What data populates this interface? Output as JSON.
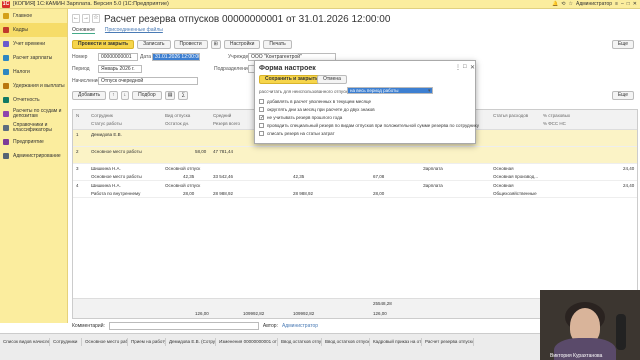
{
  "app": {
    "title": "[КОПИЯ] 1С:КАМИН Зарплата. Версия 5.0 (1С:Предприятие)",
    "user": "Администратор"
  },
  "sidebar": {
    "items": [
      {
        "label": "Главное",
        "icon": "home-icon",
        "color": "#d4a017"
      },
      {
        "label": "Кадры",
        "icon": "people-icon",
        "color": "#c0392b",
        "active": true
      },
      {
        "label": "Учет времени",
        "icon": "clock-icon",
        "color": "#6a5acd"
      },
      {
        "label": "Расчет зарплаты",
        "icon": "calculator-icon",
        "color": "#2e86c1"
      },
      {
        "label": "Налоги",
        "icon": "percent-icon",
        "color": "#2e86c1"
      },
      {
        "label": "Удержания и выплаты",
        "icon": "wallet-icon",
        "color": "#b9770e"
      },
      {
        "label": "Отчетность",
        "icon": "report-icon",
        "color": "#117a65"
      },
      {
        "label": "Расчеты по ссудам и депозитам",
        "icon": "bank-icon",
        "color": "#8e44ad"
      },
      {
        "label": "Справочники и классификаторы",
        "icon": "book-icon",
        "color": "#5d6d7e"
      },
      {
        "label": "Предприятие",
        "icon": "building-icon",
        "color": "#7d3c98"
      },
      {
        "label": "Администрирование",
        "icon": "gear-icon",
        "color": "#566573"
      }
    ]
  },
  "document": {
    "title": "Расчет резерва отпусков 00000000001 от 31.01.2026 12:00:00",
    "tabs": [
      {
        "label": "Основное"
      },
      {
        "label": "Присоединенные файлы"
      }
    ],
    "toolbar": {
      "post_close": "Провести и закрыть",
      "write": "Записать",
      "post": "Провести",
      "settings": "Настройки",
      "print": "Печать",
      "more": "Еще"
    },
    "fields": {
      "number_label": "Номер",
      "number_value": "00000000001",
      "date_label": "Дата",
      "date_value": "31.01.2026 12:00:00",
      "org_label": "Учреждение",
      "org_value": "ООО \"Контрагентрой\"",
      "period_label": "Период",
      "period_value": "Январь 2026 г.",
      "dept_label": "Подразделение",
      "accrual_label": "Начисление",
      "accrual_value": "Отпуск очередной"
    },
    "table_toolbar": {
      "add": "Добавить",
      "pick": "Подбор",
      "more": "Еще"
    },
    "columns": [
      "N",
      "Сотрудник",
      "Вид отпуска",
      "Средний",
      "",
      "",
      "Дней",
      "Подразделение",
      "Статья расходов",
      "% страховых"
    ],
    "columns2": [
      "",
      "Статус работы",
      "Остаток дн.",
      "",
      "Резерв всего",
      "",
      "",
      "Должность",
      "",
      "% ФСС НС"
    ],
    "rows": [
      {
        "n": "1",
        "employee": "Демидова Е.В.",
        "status": "",
        "type": "",
        "rest": "",
        "avg": "",
        "reserve": "",
        "days": "",
        "dept": "",
        "post": "",
        "article": "",
        "pct": ""
      },
      {
        "n": "2",
        "employee": "Основное место работы",
        "status": "",
        "type": "",
        "rest": "58,00",
        "avg": "47 781,44",
        "reserve": "",
        "days": "",
        "dept": "",
        "post": "",
        "article": "",
        "pct": ""
      },
      {
        "n": "3",
        "employee": "Шишкина Н.А.",
        "status": "Основное место работы",
        "type": "Основной отпуск",
        "rest": "42,35",
        "avg": "",
        "reserve": "33 542,46",
        "reserve2": "42,35",
        "days": "67,08",
        "dept": "Зарплата",
        "post": "Основная производ...",
        "article": "Основная",
        "pct": "24,40"
      },
      {
        "n": "4",
        "employee": "Шишкина Н.А.",
        "status": "Работа по внутреннему",
        "type": "Основной отпуск",
        "rest": "28,00",
        "avg": "",
        "reserve": "28 988,92",
        "reserve2": "28 988,92",
        "days": "28,00",
        "dept": "Зарплата",
        "post": "Общехозяйственные",
        "article": "Основная",
        "pct": "24,40"
      }
    ],
    "totals": {
      "days": "25548,28",
      "a": "126,00",
      "b": "109992,82",
      "c": "109992,82",
      "d": "126,00"
    },
    "bottom": {
      "comment_label": "Комментарий:",
      "author_label": "Автор:",
      "author_value": "Администратор"
    }
  },
  "dialog": {
    "title": "Форма настроек",
    "ok": "Сохранить и закрыть",
    "cancel": "Отмена",
    "calc_label": "рассчитать для неиспользованного отпуска",
    "calc_value": "на весь период работы",
    "options": [
      {
        "label": "добавлять в расчет уволенных в текущем месяце",
        "checked": false
      },
      {
        "label": "округлять дни за месяц при расчете до двух знаков",
        "checked": false
      },
      {
        "label": "не учитывать резерв прошлого года",
        "checked": true
      },
      {
        "label": "проводить специальный резерв по видам отпусков при положительной сумме резерва по сотруднику",
        "checked": false
      },
      {
        "label": "списать резерв на статьи затрат",
        "checked": false
      }
    ]
  },
  "taskbar": {
    "tabs": [
      "Список видов начислений",
      "Сотрудники",
      "Основное место работы",
      "Прием на работу",
      "Демидова Е.В. (Сотрудник)",
      "Изменения 00000000001 от 06.08.2...",
      "Ввод остатков отпусков",
      "Ввод остатков отпусков 00...",
      "Кадровый приказ на отпуск",
      "Расчет резерва отпусков"
    ],
    "webcam_caption": "Виктория Курахтанова"
  }
}
